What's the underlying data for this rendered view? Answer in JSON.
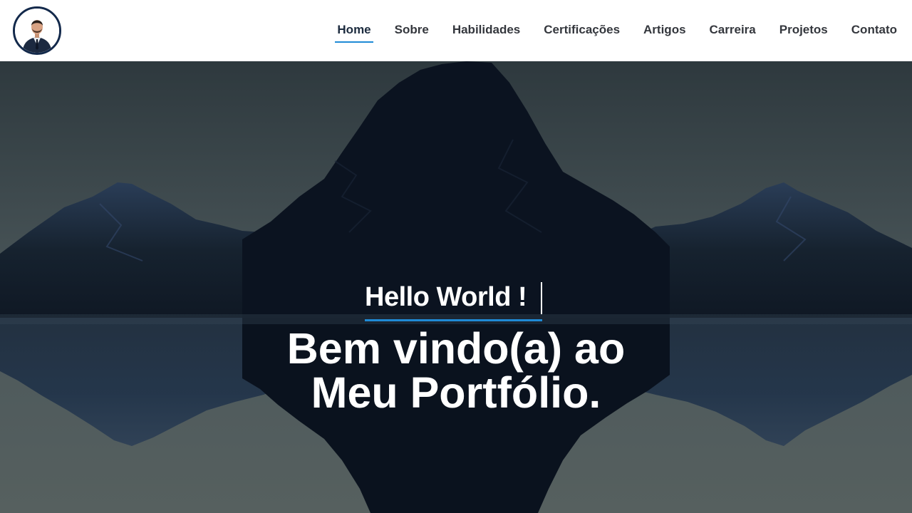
{
  "header": {
    "logo_icon": "profile-avatar-icon",
    "nav": [
      {
        "label": "Home",
        "active": true
      },
      {
        "label": "Sobre",
        "active": false
      },
      {
        "label": "Habilidades",
        "active": false
      },
      {
        "label": "Certificações",
        "active": false
      },
      {
        "label": "Artigos",
        "active": false
      },
      {
        "label": "Carreira",
        "active": false
      },
      {
        "label": "Projetos",
        "active": false
      },
      {
        "label": "Contato",
        "active": false
      }
    ]
  },
  "hero": {
    "greeting": "Hello World !",
    "headline_line1": "Bem vindo(a) ao",
    "headline_line2": "Meu Portfólio."
  },
  "colors": {
    "accent": "#1f8ad6",
    "logo_ring": "#13294b",
    "nav_text": "#34373d"
  }
}
